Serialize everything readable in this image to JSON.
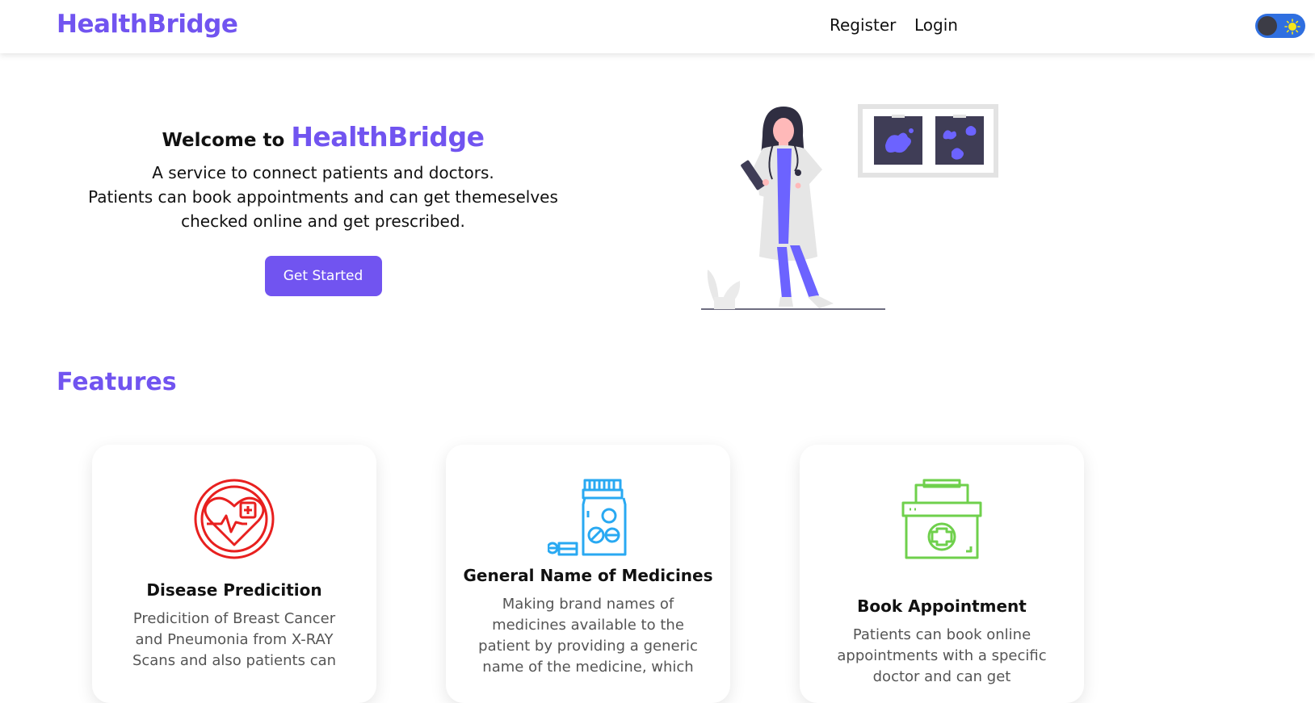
{
  "navbar": {
    "brand": "HealthBridge",
    "links": [
      {
        "label": "Register"
      },
      {
        "label": "Login"
      }
    ],
    "theme_toggle": {
      "state": "off"
    }
  },
  "hero": {
    "welcome_prefix": "Welcome to",
    "brand": "HealthBridge",
    "description_line1": "A service to connect patients and doctors.",
    "description_line2": "Patients can book appointments and can get themeselves checked online and get prescribed.",
    "cta_label": "Get Started",
    "illustration": "doctor-illustration"
  },
  "features": {
    "title": "Features",
    "items": [
      {
        "title": "Disease Predicition",
        "description": "Predicition of Breast Cancer and Pneumonia from X-RAY Scans and also patients can",
        "icon": "heart-health-icon",
        "color": "#e8201f"
      },
      {
        "title": "General Name of Medicines",
        "description": "Making brand names of medicines available to the patient by providing a generic name of the medicine, which",
        "icon": "medicine-bottle-icon",
        "color": "#29a9f2"
      },
      {
        "title": "Book Appointment",
        "description": "Patients can book online appointments with a specific doctor and can get",
        "icon": "first-aid-kit-icon",
        "color": "#6fd04c"
      }
    ]
  },
  "colors": {
    "accent": "#7154f0",
    "toggle_track": "#2f6fe0",
    "toggle_sun": "#f5e61a"
  }
}
